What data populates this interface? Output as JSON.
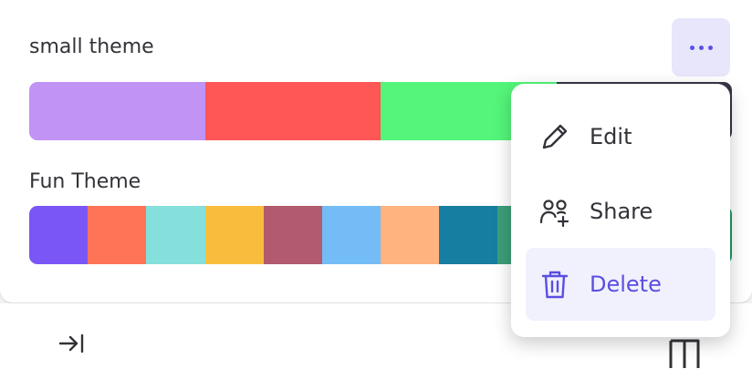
{
  "themes": [
    {
      "name": "small theme",
      "colors": [
        "#c093f5",
        "#ff5656",
        "#54f57a",
        "#363646"
      ]
    },
    {
      "name": "Fun Theme",
      "colors": [
        "#7b56f7",
        "#ff7357",
        "#85e0dc",
        "#f9bd3e",
        "#b25a6e",
        "#73bcf6",
        "#ffb37f",
        "#167fa1",
        "#3d9e78",
        "#4fb47a",
        "#2aa06a",
        "#1e9a60"
      ]
    }
  ],
  "menu": {
    "items": [
      {
        "label": "Edit",
        "icon": "pencil-icon"
      },
      {
        "label": "Share",
        "icon": "share-people-icon"
      },
      {
        "label": "Delete",
        "icon": "trash-icon"
      }
    ]
  },
  "colors": {
    "accent": "#5b51e6",
    "accent_soft": "#e7e6fb",
    "menu_highlight": "#f1f0fd"
  }
}
